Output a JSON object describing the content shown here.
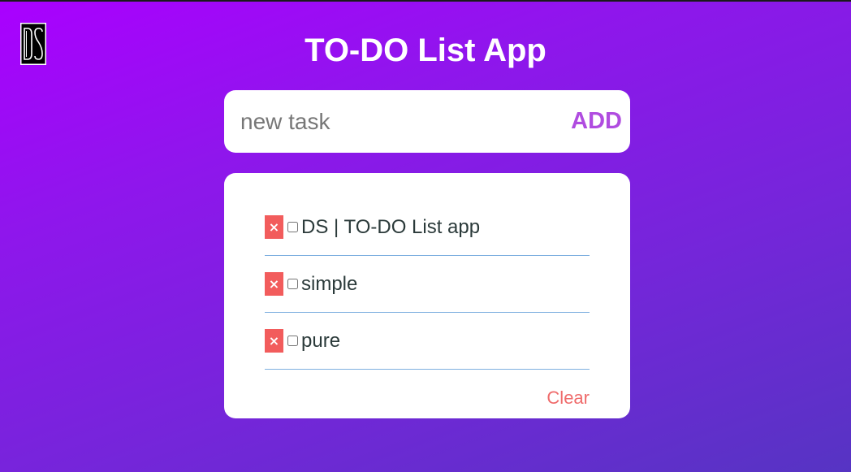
{
  "app": {
    "title": "TO-DO List App",
    "logo_icon": "ds-logo-icon"
  },
  "input": {
    "placeholder": "new task",
    "value": "",
    "add_label": "ADD"
  },
  "tasks": [
    {
      "label": "DS | TO-DO List app",
      "done": false
    },
    {
      "label": "simple",
      "done": false
    },
    {
      "label": "pure",
      "done": false
    }
  ],
  "delete_glyph": "×",
  "clear_label": "Clear",
  "colors": {
    "gradient_start": "#aa00ff",
    "gradient_end": "#5634c3",
    "accent": "#b04ce0",
    "delete": "#f25c5c",
    "clear": "#ef6b6b",
    "divider": "#7fb0e0"
  }
}
